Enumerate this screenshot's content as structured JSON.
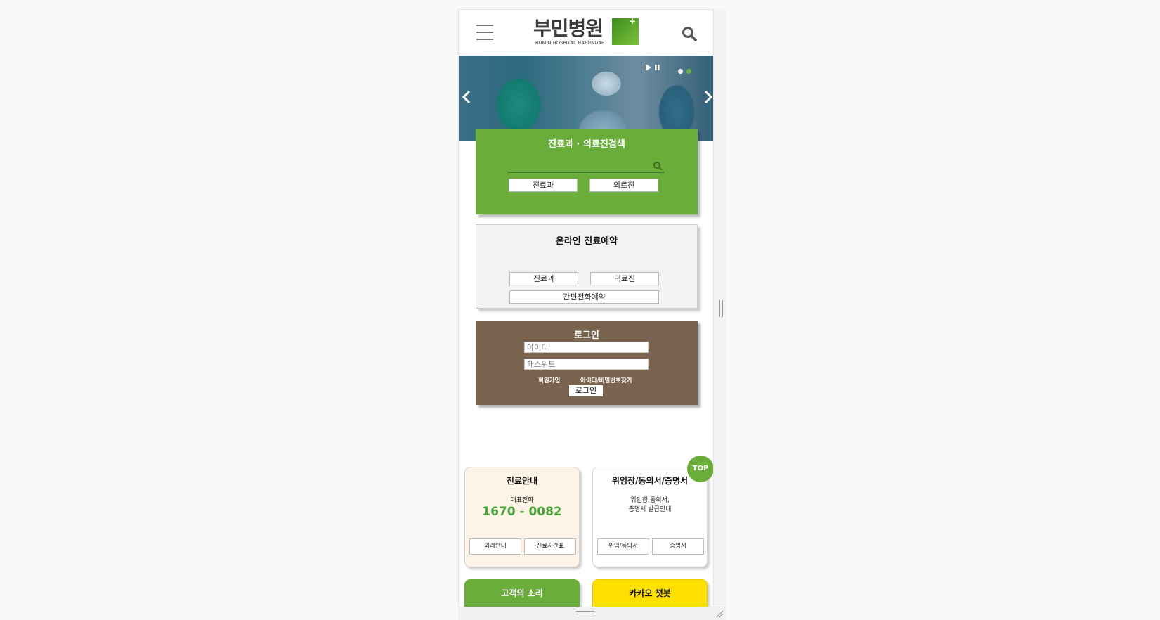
{
  "header": {
    "logo_text": "부민병원",
    "logo_sub": "BUMIN HOSPITAL HAEUNDAE"
  },
  "hero": {
    "dot_colors": [
      "#ffffff",
      "#6aad3a"
    ]
  },
  "search_card": {
    "title": "진료과 · 의료진검색",
    "search_value": "",
    "btn_department": "진료과",
    "btn_doctor": "의료진"
  },
  "reserve_card": {
    "title": "온라인 진료예약",
    "btn_department": "진료과",
    "btn_doctor": "의료진",
    "btn_phone": "간편전화예약"
  },
  "login_card": {
    "title": "로그인",
    "id_placeholder": "아이디",
    "pw_placeholder": "패스워드",
    "signup": "회원가입",
    "find": "아이디/비밀번호찾기",
    "login_btn": "로그인"
  },
  "guide_card": {
    "title": "진료안내",
    "label": "대표전화",
    "phone": "1670 - 0082",
    "btn_left": "외래안내",
    "btn_right": "진료시간표"
  },
  "docs_card": {
    "title": "위임장/동의서/증명서",
    "desc_line1": "위임장,동의서,",
    "desc_line2": "증명서 발급안내",
    "btn_left": "위임/동의서",
    "btn_right": "증명서"
  },
  "top_button": "TOP",
  "voice_card": {
    "title": "고객의 소리"
  },
  "kakao_card": {
    "title": "카카오 챗봇"
  },
  "colors": {
    "brand_green": "#6aad3a",
    "login_brown": "#7a6450",
    "kakao_yellow": "#fde000"
  }
}
